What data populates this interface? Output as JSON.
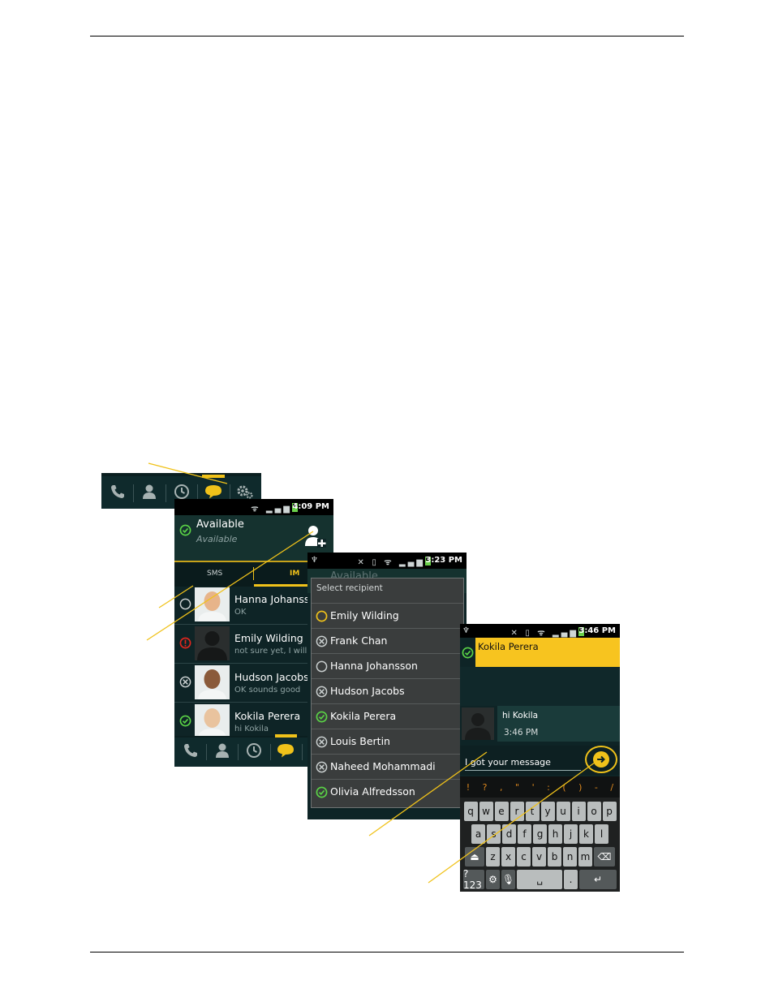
{
  "tab_strip": {
    "tabs": [
      {
        "icon": "phone-icon"
      },
      {
        "icon": "contacts-icon"
      },
      {
        "icon": "clock-icon"
      },
      {
        "icon": "chat-bubble-icon",
        "active": true
      },
      {
        "icon": "gears-icon"
      }
    ],
    "accent_color": "#f0c21a"
  },
  "screen_contacts": {
    "status_time": "4:09 PM",
    "presence_title": "Available",
    "presence_subtitle": "Available",
    "tab_sms": "SMS",
    "tab_im": "IM",
    "contacts": [
      {
        "name": "Hanna Johansson",
        "message": "OK",
        "status": "offline"
      },
      {
        "name": "Emily Wilding",
        "message": "not sure yet, I will",
        "status": "busy"
      },
      {
        "name": "Hudson Jacobs",
        "message": "OK sounds good",
        "status": "unavailable"
      },
      {
        "name": "Kokila Perera",
        "message": "hi Kokila",
        "status": "available"
      }
    ]
  },
  "screen_select": {
    "status_time": "3:23 PM",
    "background_title": "Available",
    "dialog_title": "Select recipient",
    "recipients": [
      {
        "name": "Emily Wilding",
        "status": "away"
      },
      {
        "name": "Frank Chan",
        "status": "unavailable"
      },
      {
        "name": "Hanna Johansson",
        "status": "offline"
      },
      {
        "name": "Hudson Jacobs",
        "status": "unavailable"
      },
      {
        "name": "Kokila Perera",
        "status": "available"
      },
      {
        "name": "Louis Bertin",
        "status": "unavailable"
      },
      {
        "name": "Naheed Mohammadi",
        "status": "unavailable"
      },
      {
        "name": "Olivia Alfredsson",
        "status": "available"
      }
    ]
  },
  "screen_chat": {
    "status_time": "3:46 PM",
    "contact_name": "Kokila Perera",
    "received_message": "hi Kokila",
    "received_time": "3:46 PM",
    "compose_text": "I got your message",
    "symbols": [
      "!",
      "?",
      ",",
      "\"",
      "'",
      ":",
      "(",
      ")",
      "-",
      "/"
    ],
    "keys_row1": [
      "q",
      "w",
      "e",
      "r",
      "t",
      "y",
      "u",
      "i",
      "o",
      "p"
    ],
    "keys_row2": [
      "a",
      "s",
      "d",
      "f",
      "g",
      "h",
      "j",
      "k",
      "l"
    ],
    "keys_row3": [
      "z",
      "x",
      "c",
      "v",
      "b",
      "n",
      "m"
    ],
    "key_symbols": "?123",
    "key_period": "."
  }
}
